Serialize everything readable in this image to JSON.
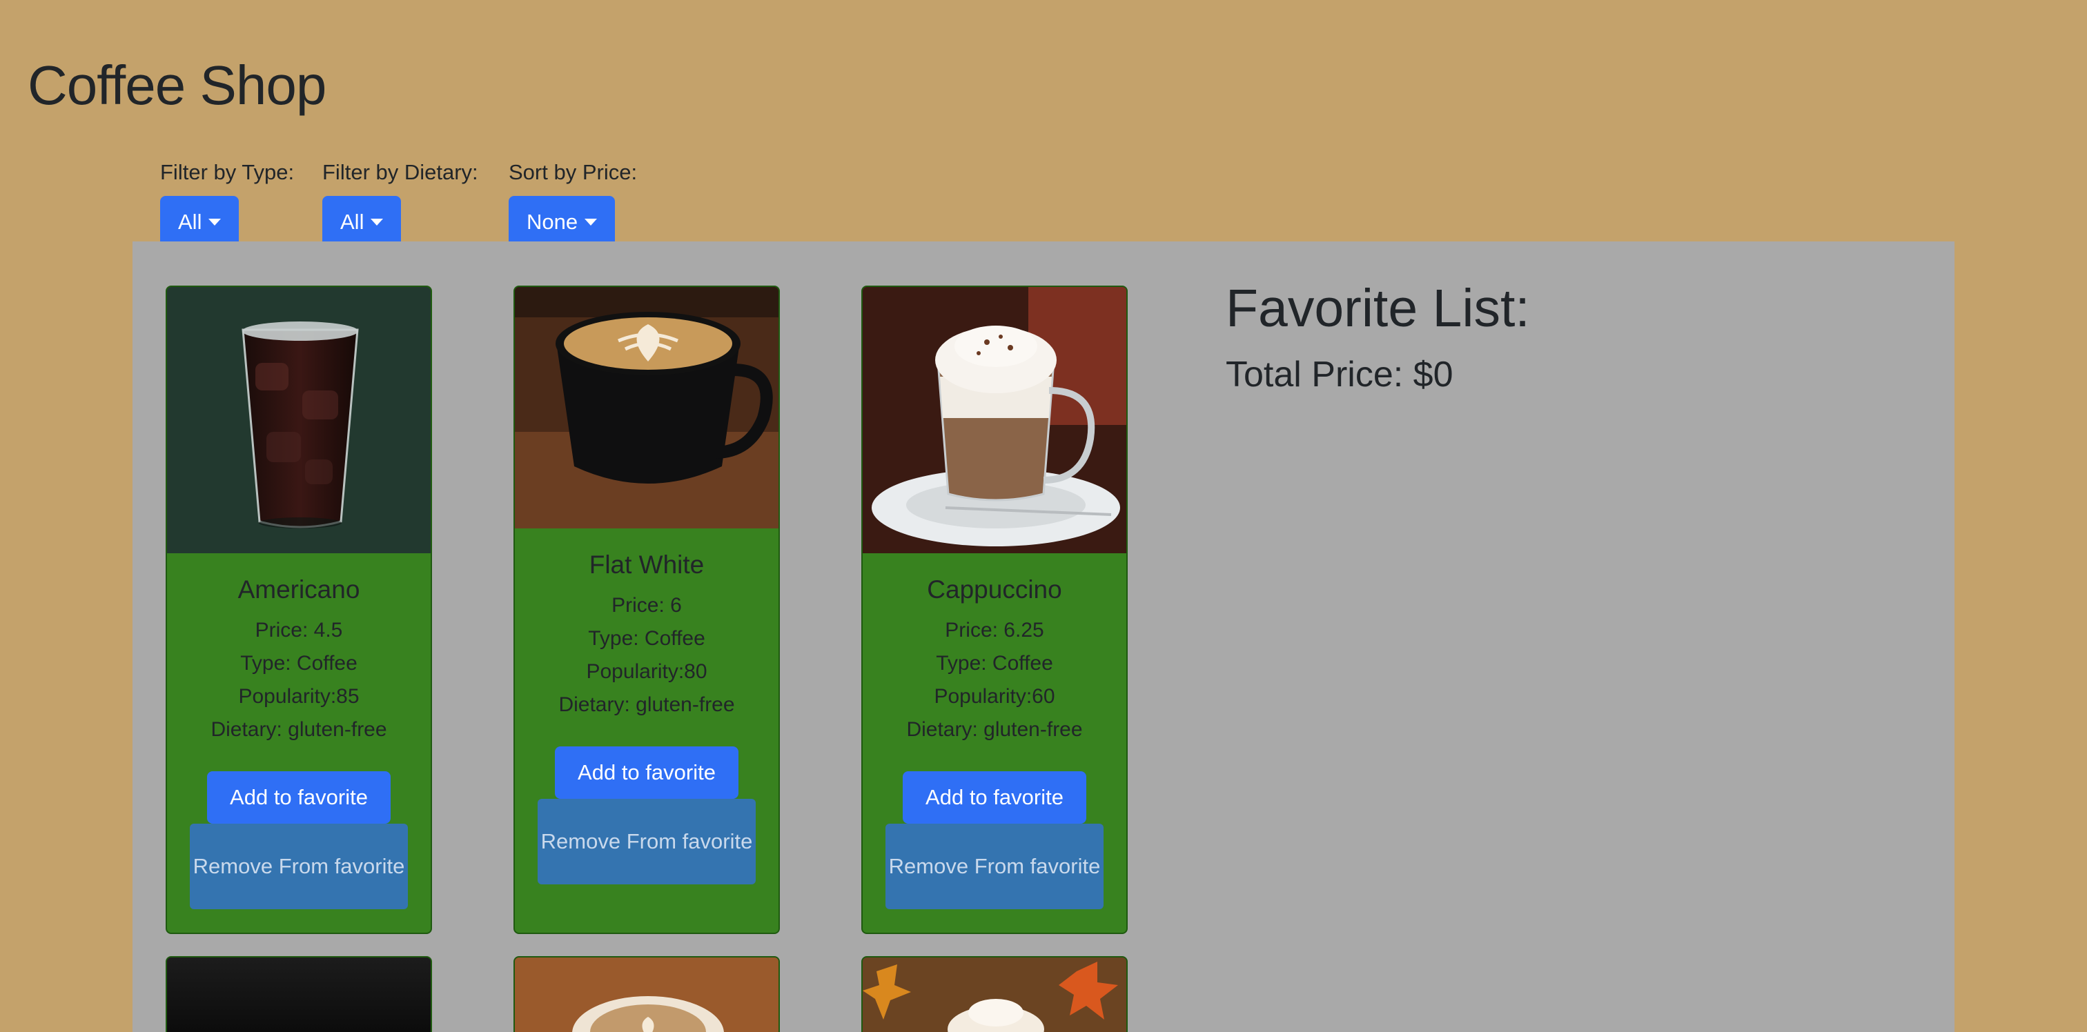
{
  "app": {
    "title": "Coffee Shop"
  },
  "filters": {
    "type": {
      "label": "Filter by Type:",
      "value": "All"
    },
    "dietary": {
      "label": "Filter by Dietary:",
      "value": "All"
    },
    "sort": {
      "label": "Sort by Price:",
      "value": "None"
    }
  },
  "labels": {
    "add": "Add to favorite",
    "remove": "Remove From favorite"
  },
  "products": [
    {
      "name": "Americano",
      "price": "Price: 4.5",
      "type": "Type: Coffee",
      "popularity": "Popularity:85",
      "dietary": "Dietary: gluten-free",
      "image": "iced-coffee-image"
    },
    {
      "name": "Flat White",
      "price": "Price: 6",
      "type": "Type: Coffee",
      "popularity": "Popularity:80",
      "dietary": "Dietary: gluten-free",
      "image": "latte-art-cup-image"
    },
    {
      "name": "Cappuccino",
      "price": "Price: 6.25",
      "type": "Type: Coffee",
      "popularity": "Popularity:60",
      "dietary": "Dietary: gluten-free",
      "image": "glass-mug-cream-image"
    }
  ],
  "favorites": {
    "title": "Favorite List:",
    "total": "Total Price: $0"
  },
  "colors": {
    "background": "#c4a26b",
    "panel": "#a9a9a9",
    "card": "#38821f",
    "primary": "#2f6ff5",
    "remove": "#3474b0"
  }
}
